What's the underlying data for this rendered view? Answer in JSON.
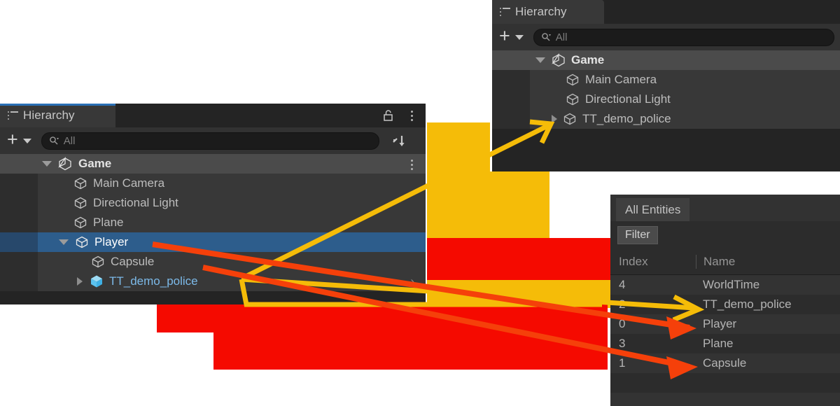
{
  "colors": {
    "yellow": "#f5bc08",
    "red": "#f50a00",
    "red_arrow": "#f5400a",
    "selection_blue": "#2d5d8c",
    "prefab_blue": "#7cb9e8",
    "panel_bg": "#242424",
    "row_bg": "#383838",
    "tab_bg": "#383838",
    "accent": "#2a6fb5"
  },
  "hierarchy_main": {
    "tab": {
      "label": "Hierarchy",
      "icon": "hierarchy-list-icon",
      "active": true
    },
    "titlebar_icons": [
      "lock-icon",
      "kebab-menu-icon"
    ],
    "toolbar": {
      "add_label": "+",
      "add_dropdown_icon": "chevron-down-icon",
      "search_icon": "search-icon",
      "search_placeholder": "All",
      "search_value": "",
      "sort_icon": "sort-icon"
    },
    "scene": {
      "label": "Game",
      "icon": "unity-scene-icon",
      "expanded": true,
      "kebab": "kebab-menu-icon"
    },
    "items": [
      {
        "label": "Main Camera",
        "icon": "gameobject-cube-icon",
        "indent": 1,
        "expandable": false,
        "selected": false,
        "prefab": false
      },
      {
        "label": "Directional Light",
        "icon": "gameobject-cube-icon",
        "indent": 1,
        "expandable": false,
        "selected": false,
        "prefab": false
      },
      {
        "label": "Plane",
        "icon": "gameobject-cube-icon",
        "indent": 1,
        "expandable": false,
        "selected": false,
        "prefab": false
      },
      {
        "label": "Player",
        "icon": "gameobject-cube-icon",
        "indent": 1,
        "expandable": true,
        "expanded": true,
        "selected": true,
        "prefab": false
      },
      {
        "label": "Capsule",
        "icon": "gameobject-cube-icon",
        "indent": 2,
        "expandable": false,
        "selected": false,
        "prefab": false
      },
      {
        "label": "TT_demo_police",
        "icon": "prefab-cube-icon",
        "indent": 2,
        "expandable": true,
        "expanded": false,
        "selected": false,
        "prefab": true
      }
    ]
  },
  "hierarchy_secondary": {
    "tab": {
      "label": "Hierarchy",
      "icon": "hierarchy-list-icon",
      "active": false
    },
    "toolbar": {
      "add_label": "+",
      "add_dropdown_icon": "chevron-down-icon",
      "search_icon": "search-icon",
      "search_placeholder": "All",
      "search_value": ""
    },
    "scene": {
      "label": "Game",
      "icon": "unity-scene-icon",
      "expanded": true
    },
    "items": [
      {
        "label": "Main Camera",
        "icon": "gameobject-cube-icon",
        "indent": 1,
        "expandable": false
      },
      {
        "label": "Directional Light",
        "icon": "gameobject-cube-icon",
        "indent": 1,
        "expandable": false
      },
      {
        "label": "TT_demo_police",
        "icon": "gameobject-cube-icon",
        "indent": 1,
        "expandable": true,
        "expanded": false
      }
    ]
  },
  "entities_window": {
    "tab": {
      "label": "All Entities"
    },
    "filter_button": {
      "label": "Filter"
    },
    "columns": [
      "Index",
      "Name"
    ],
    "rows": [
      {
        "index": "4",
        "name": "WorldTime"
      },
      {
        "index": "2",
        "name": "TT_demo_police"
      },
      {
        "index": "0",
        "name": "Player"
      },
      {
        "index": "3",
        "name": "Plane"
      },
      {
        "index": "1",
        "name": "Capsule"
      }
    ]
  },
  "annotations": {
    "arrows": [
      {
        "name": "arrow-police-to-secondary-hierarchy",
        "color": "#f5bc08",
        "head": "open"
      },
      {
        "name": "arrow-police-to-entity-row",
        "color": "#f5bc08",
        "head": "open"
      },
      {
        "name": "arrow-player-to-entity-row",
        "color": "#f5400a",
        "head": "solid"
      },
      {
        "name": "arrow-capsule-to-entity-row",
        "color": "#f5400a",
        "head": "solid"
      }
    ],
    "highlight_blocks": [
      {
        "name": "yellow-block-upper",
        "color": "#f5bc08"
      },
      {
        "name": "yellow-block-lower",
        "color": "#f5bc08"
      },
      {
        "name": "red-block-upper",
        "color": "#f50a00"
      },
      {
        "name": "red-block-lower",
        "color": "#f50a00"
      },
      {
        "name": "yellow-strip-row",
        "color": "#f5bc08"
      }
    ]
  }
}
